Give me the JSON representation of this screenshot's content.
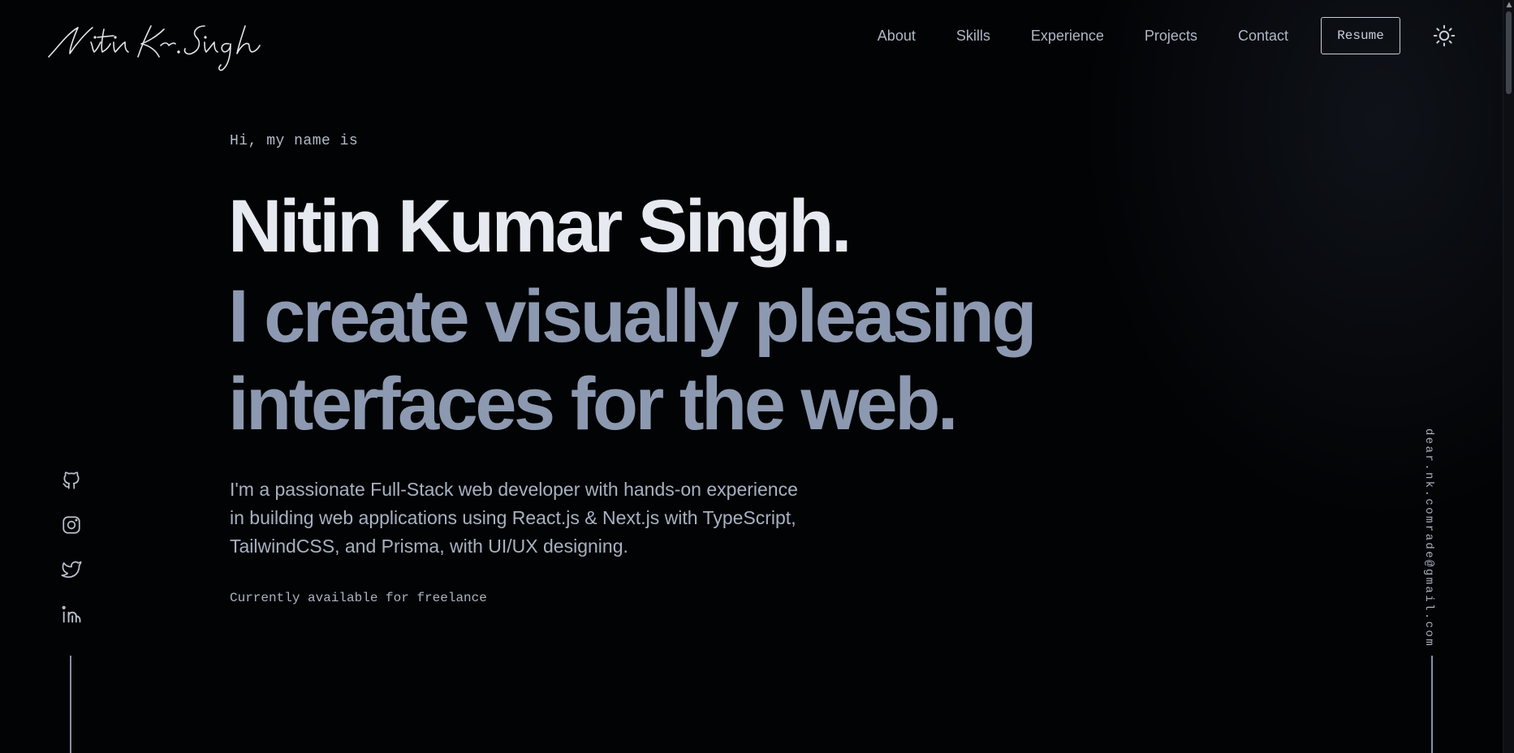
{
  "header": {
    "logo_text": "Nitin Kr. Singh",
    "nav": [
      {
        "label": "About"
      },
      {
        "label": "Skills"
      },
      {
        "label": "Experience"
      },
      {
        "label": "Projects"
      },
      {
        "label": "Contact"
      }
    ],
    "resume_label": "Resume",
    "theme_toggle_icon": "sun-icon"
  },
  "hero": {
    "greeting": "Hi, my name is",
    "name": "Nitin Kumar Singh.",
    "tagline": "I create visually pleasing interfaces for the web.",
    "description": "I'm a passionate Full-Stack web developer with hands-on experience in building web applications using React.js & Next.js with TypeScript, TailwindCSS, and Prisma, with UI/UX designing.",
    "availability": "Currently available for freelance"
  },
  "social": [
    {
      "icon": "github-icon"
    },
    {
      "icon": "instagram-icon"
    },
    {
      "icon": "twitter-icon"
    },
    {
      "icon": "linkedin-icon"
    }
  ],
  "email": "dear.nk.comrade@gmail.com",
  "colors": {
    "background": "#020305",
    "heading": "#e6eaf0",
    "tagline": "#8c99b0",
    "body_text": "#a7b1c1",
    "rail_line": "#8390a6"
  }
}
